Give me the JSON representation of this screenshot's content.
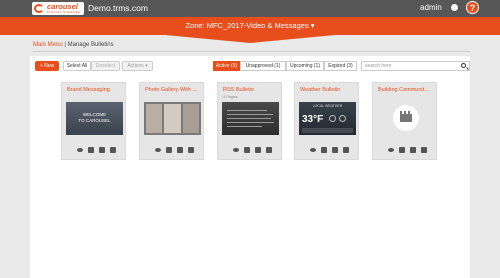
{
  "brand": {
    "logo_text": "carousel",
    "logo_sub": "DIGITAL SIGNAGE",
    "color": "#e84e1b"
  },
  "header": {
    "domain": "Demo.trms.com",
    "user": "admin",
    "help": "?"
  },
  "zone": {
    "title": "Zone: MFC_2017-Video & Messages ▾"
  },
  "breadcrumb": {
    "main_menu": "Main Menu",
    "separator": " | ",
    "current": "Manage Bulletins"
  },
  "toolbar": {
    "new_label": "+ New",
    "select_all_label": "Select All",
    "deselect_label": "Deselect",
    "actions_label": "Actions ▾"
  },
  "filters": {
    "active": "Active (5)",
    "unapproved": "Unapproved (1)",
    "upcoming": "Upcoming (1)",
    "expired": "Expired (3)"
  },
  "search": {
    "placeholder": "search here"
  },
  "cards": [
    {
      "title": "Brand Messaging",
      "thumb_line1": "WELCOME",
      "thumb_line2": "TO CAROUSEL"
    },
    {
      "title": "Photo Gallery With ..."
    },
    {
      "title": "RSS Bulletin",
      "subtitle": "4 Pages"
    },
    {
      "title": "Weather Bulletin",
      "thumb_header": "LOCAL WEATHER",
      "thumb_temp": "33°F"
    },
    {
      "title": "Building Communit..."
    }
  ]
}
